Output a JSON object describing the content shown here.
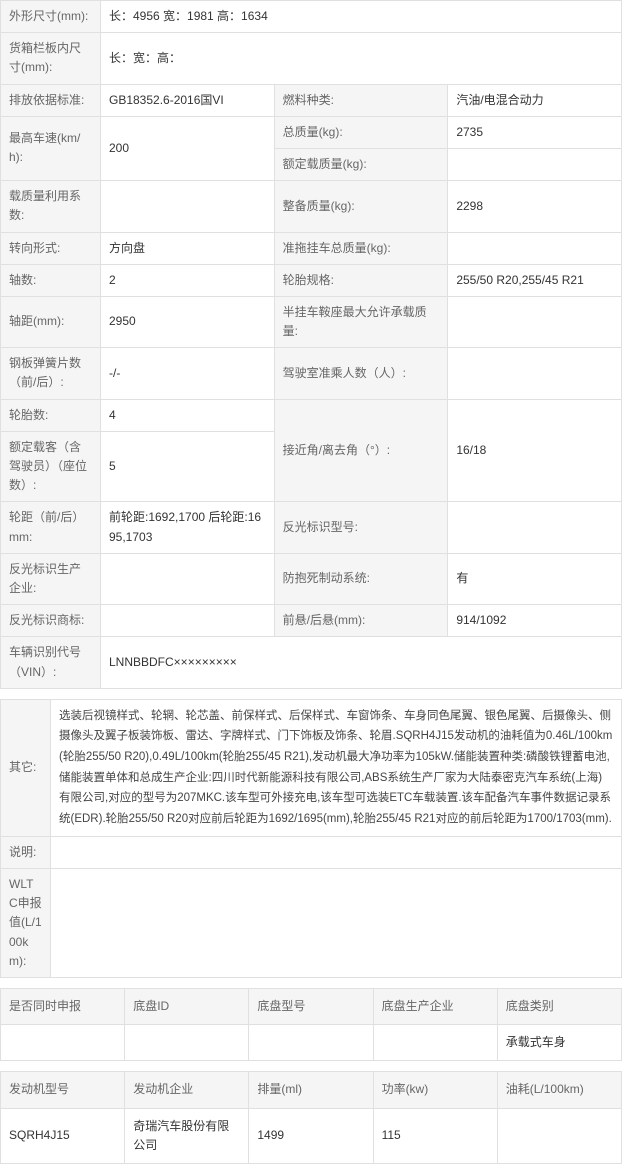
{
  "spec": {
    "outer_dim_lbl": "外形尺寸(mm):",
    "outer_dim_val": "长：4956 宽：1981 高：1634",
    "cargo_dim_lbl": "货箱栏板内尺寸(mm):",
    "cargo_dim_val": "长：宽：高：",
    "emission_std_lbl": "排放依据标准:",
    "emission_std_val": "GB18352.6-2016国VI",
    "fuel_type_lbl": "燃料种类:",
    "fuel_type_val": "汽油/电混合动力",
    "max_speed_lbl": "最高车速(km/h):",
    "max_speed_val": "200",
    "gross_mass_lbl": "总质量(kg):",
    "gross_mass_val": "2735",
    "load_coeff_lbl": "载质量利用系数:",
    "load_coeff_val": "",
    "rated_load_lbl": "额定载质量(kg):",
    "rated_load_val": "",
    "steering_lbl": "转向形式:",
    "steering_val": "方向盘",
    "curb_mass_lbl": "整备质量(kg):",
    "curb_mass_val": "2298",
    "axle_count_lbl": "轴数:",
    "axle_count_val": "2",
    "trailer_mass_lbl": "准拖挂车总质量(kg):",
    "trailer_mass_val": "",
    "wheelbase_lbl": "轴距(mm):",
    "wheelbase_val": "2950",
    "tire_spec_lbl": "轮胎规格:",
    "tire_spec_val": "255/50 R20,255/45 R21",
    "spring_count_lbl": "钢板弹簧片数（前/后）:",
    "spring_count_val": "-/-",
    "saddle_load_lbl": "半挂车鞍座最大允许承载质量:",
    "saddle_load_val": "",
    "tire_count_lbl": "轮胎数:",
    "tire_count_val": "4",
    "cab_seats_lbl": "驾驶室准乘人数（人）:",
    "cab_seats_val": "",
    "rated_seats_lbl": "额定载客（含驾驶员）（座位数）:",
    "rated_seats_val": "5",
    "track_lbl": "轮距（前/后）mm:",
    "track_val": "前轮距:1692,1700 后轮距:1695,1703",
    "approach_lbl": "接近角/离去角（°）:",
    "approach_val": "16/18",
    "reflector_co_lbl": "反光标识生产企业:",
    "reflector_co_val": "",
    "reflector_type_lbl": "反光标识型号:",
    "reflector_type_val": "",
    "reflector_brand_lbl": "反光标识商标:",
    "reflector_brand_val": "",
    "abs_lbl": "防抱死制动系统:",
    "abs_val": "有",
    "vin_lbl": "车辆识别代号（VIN）:",
    "vin_val": "LNNBBDFC×××××××××",
    "overhang_lbl": "前悬/后悬(mm):",
    "overhang_val": "914/1092"
  },
  "remarks": {
    "other_lbl": "其它:",
    "other_val": "选装后视镜样式、轮辋、轮芯盖、前保样式、后保样式、车窗饰条、车身同色尾翼、银色尾翼、后摄像头、侧摄像头及翼子板装饰板、雷达、字牌样式、门下饰板及饰条、轮眉.SQRH4J15发动机的油耗值为0.46L/100km(轮胎255/50 R20),0.49L/100km(轮胎255/45 R21),发动机最大净功率为105kW.储能装置种类:磷酸铁锂蓄电池,储能装置单体和总成生产企业:四川时代新能源科技有限公司,ABS系统生产厂家为大陆泰密克汽车系统(上海)有限公司,对应的型号为207MKC.该车型可外接充电,该车型可选装ETC车载装置.该车配备汽车事件数据记录系统(EDR).轮胎255/50 R20对应前后轮距为1692/1695(mm),轮胎255/45 R21对应的前后轮距为1700/1703(mm).",
    "note_lbl": "说明:",
    "note_val": "",
    "wltc_lbl": "WLTC申报值(L/100km):",
    "wltc_val": ""
  },
  "chassis": {
    "q_lbl": "是否同时申报",
    "id_lbl": "底盘ID",
    "model_lbl": "底盘型号",
    "maker_lbl": "底盘生产企业",
    "cat_lbl": "底盘类别",
    "row": {
      "q": "",
      "id": "",
      "model": "",
      "maker": "",
      "cat": "承载式车身"
    }
  },
  "engine": {
    "model_lbl": "发动机型号",
    "maker_lbl": "发动机企业",
    "disp_lbl": "排量(ml)",
    "power_lbl": "功率(kw)",
    "fuel_lbl": "油耗(L/100km)",
    "row": {
      "model": "SQRH4J15",
      "maker": "奇瑞汽车股份有限公司",
      "disp": "1499",
      "power": "115",
      "fuel": ""
    }
  }
}
